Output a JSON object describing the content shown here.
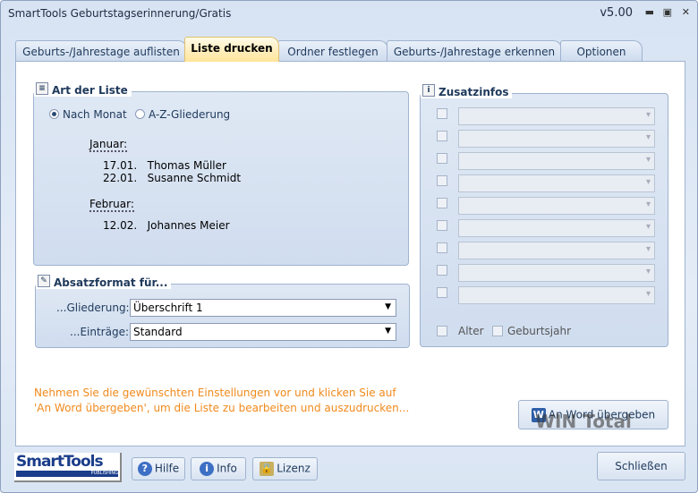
{
  "window": {
    "title": "SmartTools Geburtstagserinnerung/Gratis",
    "version": "v5.00"
  },
  "tabs": [
    "Geburts-/Jahrestage auflisten",
    "Liste drucken",
    "Ordner festlegen",
    "Geburts-/Jahrestage erkennen",
    "Optionen"
  ],
  "art": {
    "title": "Art der Liste",
    "radio1": "Nach Monat",
    "radio2": "A-Z-Gliederung",
    "preview": [
      {
        "month": "Januar:",
        "entries": [
          {
            "date": "17.01.",
            "name": "Thomas Müller"
          },
          {
            "date": "22.01.",
            "name": "Susanne Schmidt"
          }
        ]
      },
      {
        "month": "Februar:",
        "entries": [
          {
            "date": "12.02.",
            "name": "Johannes Meier"
          }
        ]
      }
    ]
  },
  "absatz": {
    "title": "Absatzformat für...",
    "label1": "...Gliederung:",
    "value1": "Überschrift 1",
    "label2": "...Einträge:",
    "value2": "Standard"
  },
  "zusatz": {
    "title": "Zusatzinfos",
    "alter": "Alter",
    "geburtsjahr": "Geburtsjahr"
  },
  "hint": "Nehmen Sie die gewünschten Einstellungen vor und klicken Sie auf 'An Word übergeben', um die Liste zu bearbeiten und auszudrucken...",
  "buttons": {
    "word": "An Word übergeben",
    "hilfe": "Hilfe",
    "info": "Info",
    "lizenz": "Lizenz",
    "close": "Schließen"
  },
  "logo": {
    "main": "SmartTools",
    "sub": "PUBLISHING"
  },
  "watermark": "WIN Total"
}
